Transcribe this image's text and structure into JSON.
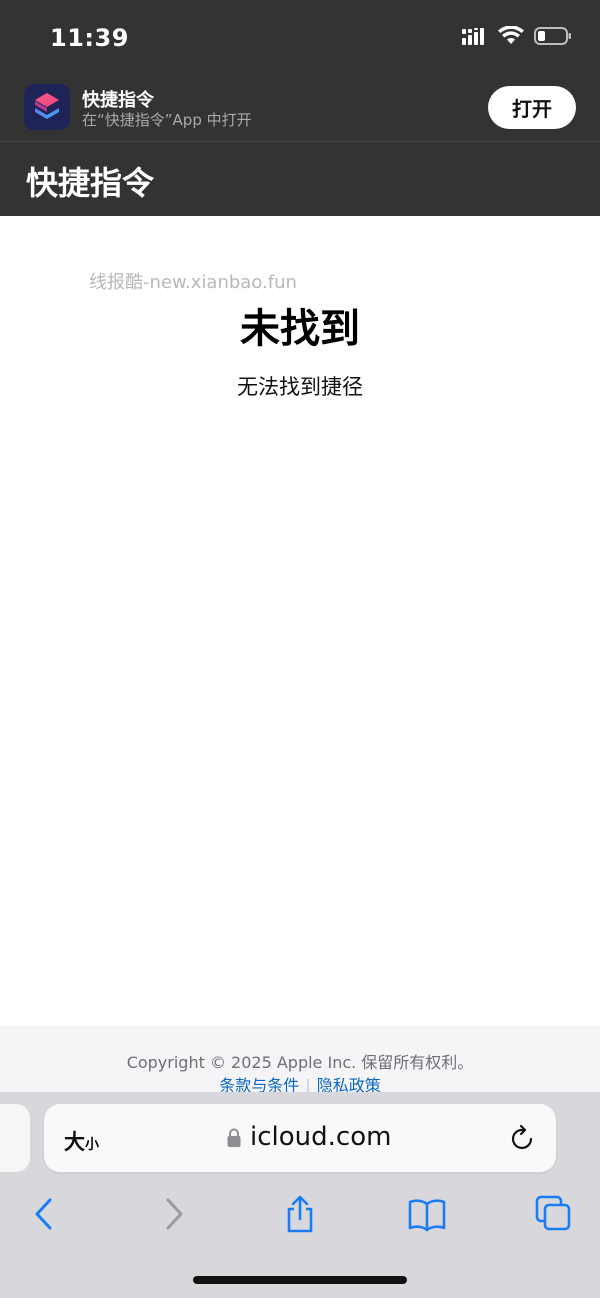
{
  "status_bar": {
    "time": "11:39",
    "icons": [
      "cellular-signal-icon",
      "wifi-icon",
      "battery-icon"
    ]
  },
  "app_banner": {
    "app_name": "快捷指令",
    "subtitle": "在“快捷指令”App 中打开",
    "open_label": "打开",
    "icon": "shortcuts-app-icon"
  },
  "page_header": {
    "title": "快捷指令"
  },
  "content": {
    "watermark": "线报酷-new.xianbao.fun",
    "title": "未找到",
    "description": "无法找到捷径"
  },
  "footer": {
    "copyright": "Copyright © 2025 Apple Inc. 保留所有权利。",
    "terms_label": "条款与条件",
    "privacy_label": "隐私政策"
  },
  "safari": {
    "text_size_big": "大",
    "text_size_small": "小",
    "url": "icloud.com",
    "toolbar_icons": [
      "back-icon",
      "forward-icon",
      "share-icon",
      "bookmarks-icon",
      "tabs-icon"
    ]
  },
  "colors": {
    "header_bg": "#333333",
    "link": "#0a66c2",
    "toolbar_blue": "#1a7cf5",
    "toolbar_gray_bg": "#d7d7dc"
  }
}
